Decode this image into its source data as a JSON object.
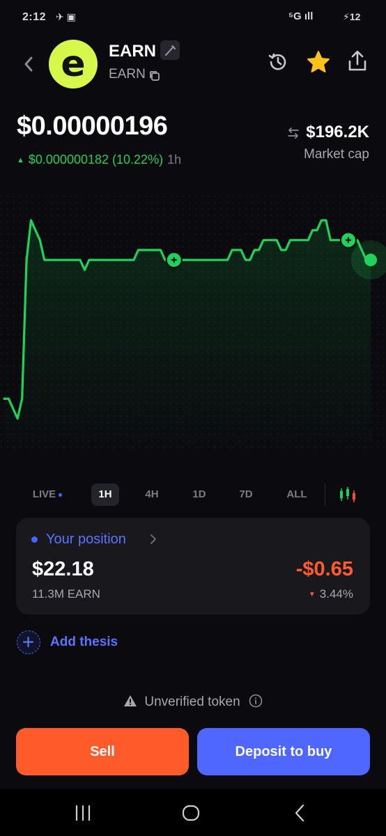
{
  "status_bar": {
    "time": "2:12",
    "left_icons": "✈ ▣",
    "network": "⁵G ıll",
    "battery": "⚡12"
  },
  "token": {
    "name": "EARN",
    "symbol": "EARN",
    "logo_letter": "e",
    "price": "$0.00000196",
    "change_abs": "$0.000000182",
    "change_pct": "(10.22%)",
    "change_period": "1h",
    "market_cap": "$196.2K",
    "market_cap_label": "Market cap"
  },
  "colors": {
    "accent_blue": "#4f67ff",
    "up_green": "#21d05b",
    "down_orange": "#ff5a2a",
    "logo_lime": "#d6f84a"
  },
  "icons": {
    "back": "chevron-left-icon",
    "edit": "pen-icon",
    "copy": "copy-icon",
    "history": "history-icon",
    "favorite": "star-icon",
    "share": "share-icon"
  },
  "chart_data": {
    "type": "line",
    "title": "",
    "grid": false,
    "series": [
      {
        "values": [
          182,
          182,
          181,
          180,
          182,
          196,
          200,
          199,
          198,
          196,
          196,
          196,
          196,
          196,
          196,
          196,
          196,
          196,
          195,
          196,
          196,
          196,
          196,
          196,
          196,
          196,
          196,
          196,
          196,
          196,
          197,
          197,
          197,
          197,
          197,
          197,
          196,
          196,
          196,
          196,
          196,
          196,
          196,
          196,
          196,
          196,
          196,
          196,
          196,
          196,
          196,
          197,
          197,
          197,
          196,
          196,
          197,
          197,
          198,
          198,
          198,
          198,
          197,
          197,
          198,
          198,
          198,
          198,
          198,
          199,
          199,
          200,
          200,
          198,
          198,
          198,
          198,
          198,
          198,
          198,
          197,
          196,
          196
        ]
      }
    ],
    "trade_markers": [
      "buy",
      "buy"
    ]
  },
  "range_tabs": [
    {
      "label": "LIVE",
      "live": true
    },
    {
      "label": "1H",
      "active": true
    },
    {
      "label": "4H"
    },
    {
      "label": "1D"
    },
    {
      "label": "7D"
    },
    {
      "label": "ALL"
    }
  ],
  "position": {
    "title": "Your position",
    "value": "$22.18",
    "amount": "11.3M EARN",
    "pnl": "-$0.65",
    "pnl_pct": "3.44%"
  },
  "thesis": {
    "label": "Add thesis"
  },
  "warning": {
    "label": "Unverified token"
  },
  "actions": {
    "sell_label": "Sell",
    "buy_label": "Deposit to buy"
  }
}
